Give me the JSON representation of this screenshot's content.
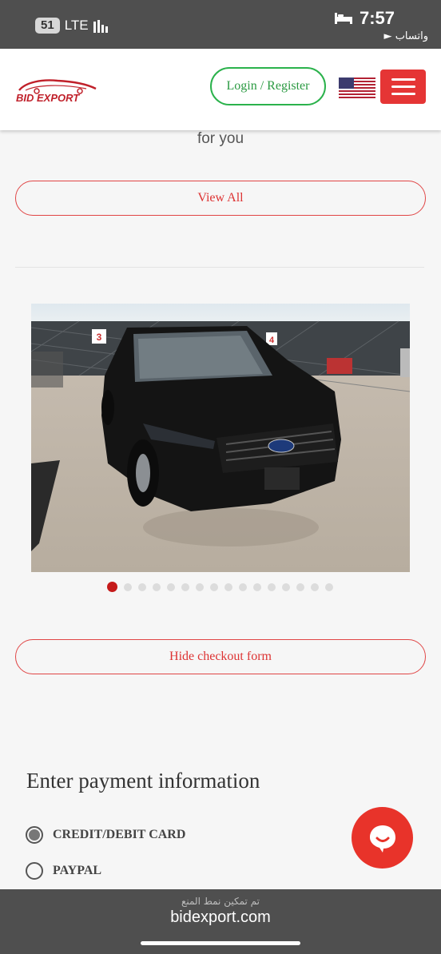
{
  "status_bar": {
    "carrier_badge": "51",
    "network": "LTE",
    "time": "7:57",
    "back_app": "► واتساب"
  },
  "header": {
    "logo_text": "BID EXPORT",
    "login_label": "Login / Register",
    "flag": "us-flag-icon",
    "menu_icon": "hamburger-icon",
    "accent": "#e53535",
    "login_color": "#2bb24c"
  },
  "content": {
    "for_you_text": "for you",
    "view_all_label": "View All",
    "carousel": {
      "total_images": 16,
      "active_index": 0,
      "lot_signs": [
        "3",
        "4"
      ]
    },
    "hide_checkout_label": "Hide checkout form"
  },
  "payment": {
    "title": "Enter payment information",
    "options": [
      {
        "label": "CREDIT/DEBIT CARD",
        "selected": true
      },
      {
        "label": "PAYPAL",
        "selected": false
      }
    ]
  },
  "browser_bar": {
    "notice": "تم تمكين نمط المنع",
    "url": "bidexport.com"
  }
}
